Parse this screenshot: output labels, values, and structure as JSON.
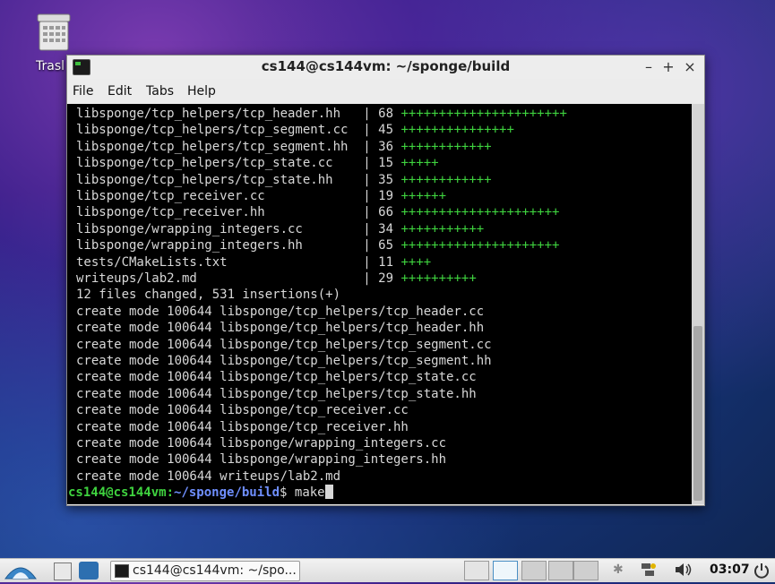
{
  "desktop": {
    "trash_label": "Trasl"
  },
  "window": {
    "title": "cs144@cs144vm: ~/sponge/build",
    "controls": {
      "minimize": "–",
      "maximize": "+",
      "close": "×"
    },
    "menu": [
      "File",
      "Edit",
      "Tabs",
      "Help"
    ]
  },
  "terminal": {
    "stat_lines": [
      {
        "file": "libsponge/tcp_helpers/tcp_header.hh  ",
        "count": "68",
        "plus": "++++++++++++++++++++++"
      },
      {
        "file": "libsponge/tcp_helpers/tcp_segment.cc ",
        "count": "45",
        "plus": "+++++++++++++++"
      },
      {
        "file": "libsponge/tcp_helpers/tcp_segment.hh ",
        "count": "36",
        "plus": "++++++++++++"
      },
      {
        "file": "libsponge/tcp_helpers/tcp_state.cc   ",
        "count": "15",
        "plus": "+++++"
      },
      {
        "file": "libsponge/tcp_helpers/tcp_state.hh   ",
        "count": "35",
        "plus": "++++++++++++"
      },
      {
        "file": "libsponge/tcp_receiver.cc            ",
        "count": "19",
        "plus": "++++++"
      },
      {
        "file": "libsponge/tcp_receiver.hh            ",
        "count": "66",
        "plus": "+++++++++++++++++++++"
      },
      {
        "file": "libsponge/wrapping_integers.cc       ",
        "count": "34",
        "plus": "+++++++++++"
      },
      {
        "file": "libsponge/wrapping_integers.hh       ",
        "count": "65",
        "plus": "+++++++++++++++++++++"
      },
      {
        "file": "tests/CMakeLists.txt                 ",
        "count": "11",
        "plus": "++++"
      },
      {
        "file": "writeups/lab2.md                     ",
        "count": "29",
        "plus": "++++++++++"
      }
    ],
    "summary": "12 files changed, 531 insertions(+)",
    "create_lines": [
      "create mode 100644 libsponge/tcp_helpers/tcp_header.cc",
      "create mode 100644 libsponge/tcp_helpers/tcp_header.hh",
      "create mode 100644 libsponge/tcp_helpers/tcp_segment.cc",
      "create mode 100644 libsponge/tcp_helpers/tcp_segment.hh",
      "create mode 100644 libsponge/tcp_helpers/tcp_state.cc",
      "create mode 100644 libsponge/tcp_helpers/tcp_state.hh",
      "create mode 100644 libsponge/tcp_receiver.cc",
      "create mode 100644 libsponge/tcp_receiver.hh",
      "create mode 100644 libsponge/wrapping_integers.cc",
      "create mode 100644 libsponge/wrapping_integers.hh",
      "create mode 100644 writeups/lab2.md"
    ],
    "prompt": {
      "user": "cs144@cs144vm",
      "sep": ":",
      "path": "~/sponge/build",
      "symbol": "$",
      "command": " make"
    }
  },
  "taskbar": {
    "task_label": "cs144@cs144vm: ~/spo...",
    "clock": "03:07",
    "icons": [
      "start-menu-icon",
      "file-manager-icon",
      "desktop-switch-icon",
      "bluetooth-icon",
      "network-icon",
      "volume-icon",
      "power-icon"
    ]
  },
  "colors": {
    "terminal_bg": "#000000",
    "terminal_fg": "#d8d8d8",
    "plus_green": "#3fd33f",
    "prompt_path": "#6f8fff"
  }
}
